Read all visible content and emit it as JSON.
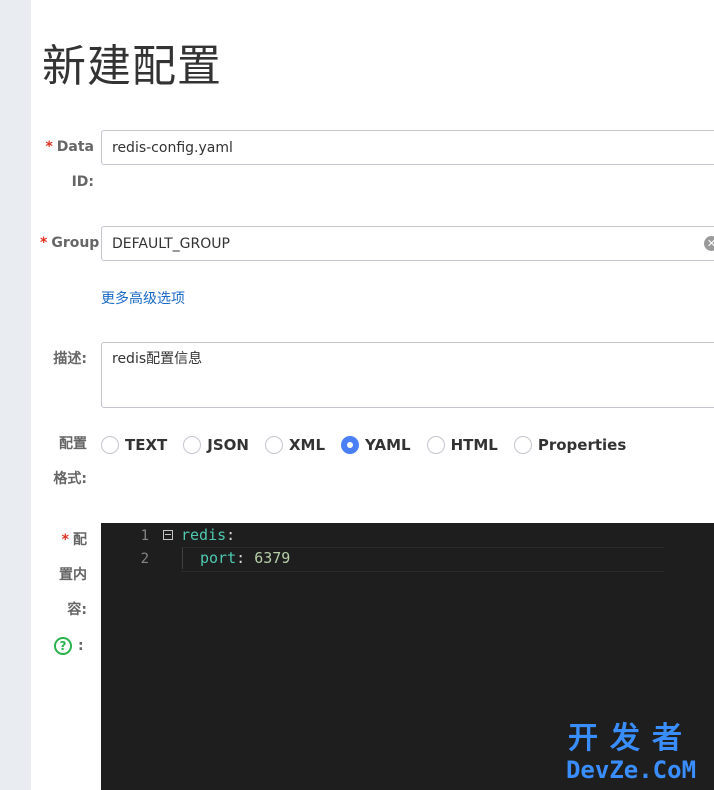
{
  "page": {
    "title": "新建配置"
  },
  "form": {
    "data_id": {
      "required_mark": "*",
      "label_line1": "Data",
      "label_line2": "ID:",
      "value": "redis-config.yaml"
    },
    "group": {
      "required_mark": "*",
      "label": "Group",
      "value": "DEFAULT_GROUP",
      "clear_icon": "close-circle-icon"
    },
    "advanced_link": "更多高级选项",
    "description": {
      "label": "描述:",
      "value": "redis配置信息"
    },
    "format": {
      "label_line1": "配置",
      "label_line2": "格式:",
      "options": [
        "TEXT",
        "JSON",
        "XML",
        "YAML",
        "HTML",
        "Properties"
      ],
      "selected": "YAML",
      "accent_color": "#4a7ff5"
    },
    "content": {
      "required_mark": "*",
      "label_line1": "配",
      "label_line2": "置内",
      "label_line3": "容:",
      "help_icon": "question-circle-icon",
      "help_colon": ":",
      "line_numbers": [
        "1",
        "2"
      ],
      "lines": [
        {
          "key": "redis",
          "sep": ":",
          "value": ""
        },
        {
          "key": "port",
          "sep": ": ",
          "value": "6379"
        }
      ]
    }
  },
  "watermark": {
    "cn": "开发者",
    "en": "DevZe.CoM"
  }
}
